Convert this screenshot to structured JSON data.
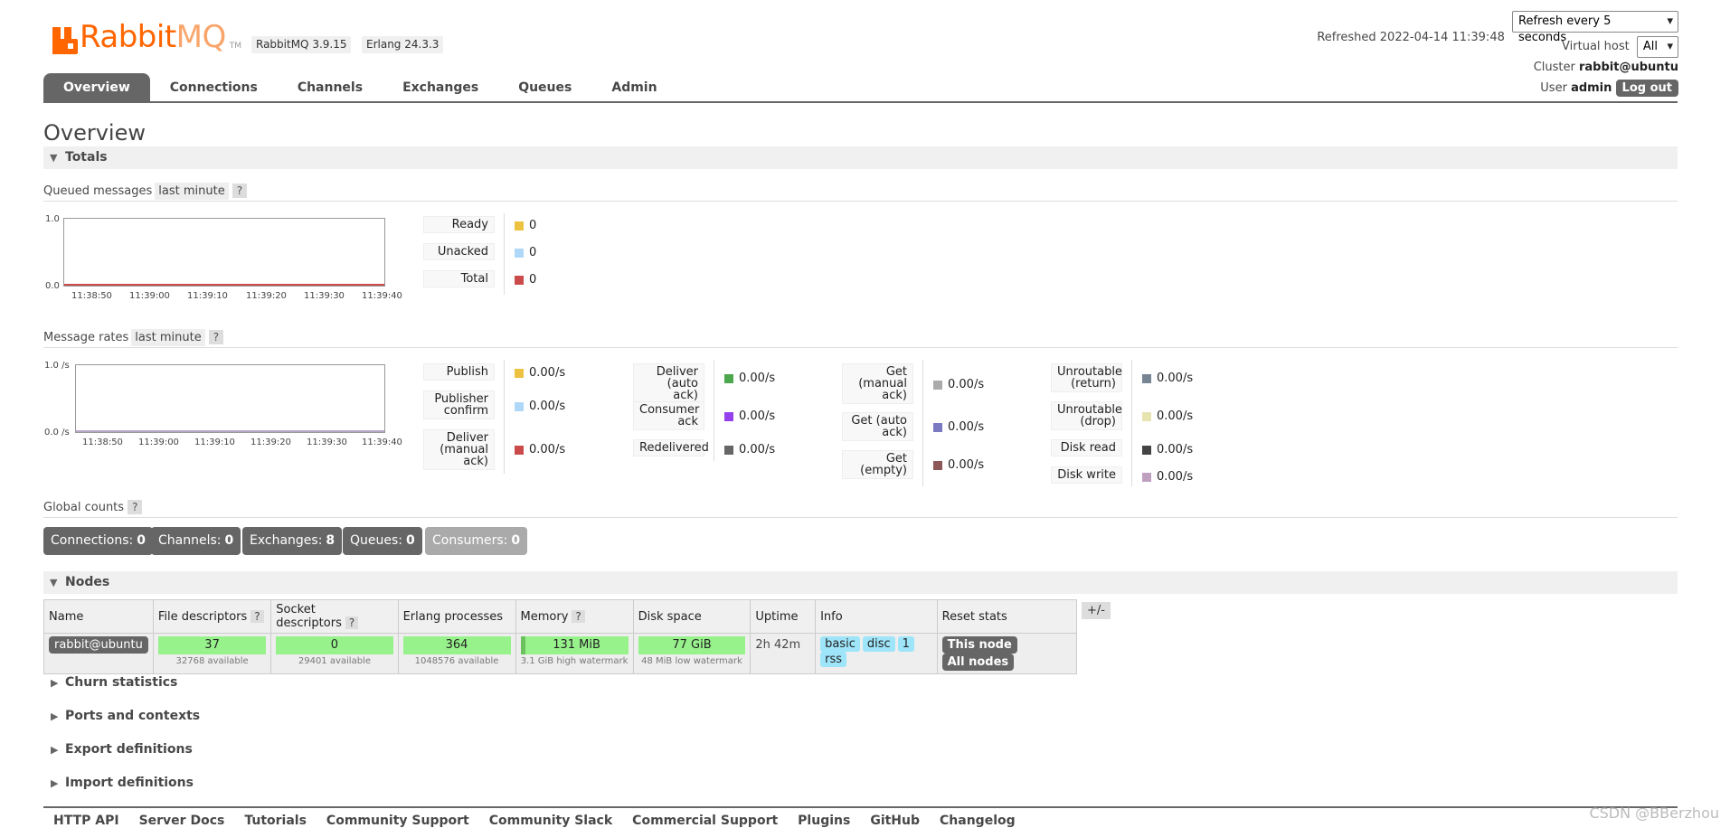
{
  "app": {
    "logo_text_a": "Rabbit",
    "logo_text_b": "MQ",
    "tm": "TM",
    "version": "RabbitMQ 3.9.15",
    "erlang": "Erlang 24.3.3"
  },
  "status": {
    "refreshed_label": "Refreshed 2022-04-14 11:39:48",
    "refresh_select": "Refresh every 5 seconds",
    "vhost_label": "Virtual host",
    "vhost_select": "All",
    "cluster_label": "Cluster",
    "cluster_value": "rabbit@ubuntu",
    "user_label": "User",
    "user_value": "admin",
    "logout": "Log out"
  },
  "tabs": [
    {
      "label": "Overview",
      "active": true
    },
    {
      "label": "Connections"
    },
    {
      "label": "Channels"
    },
    {
      "label": "Exchanges"
    },
    {
      "label": "Queues"
    },
    {
      "label": "Admin"
    }
  ],
  "page_title": "Overview",
  "totals": {
    "header": "Totals",
    "queued": {
      "title": "Queued messages",
      "range": "last minute",
      "help": "?",
      "chart": {
        "y_top": "1.0",
        "y_bottom": "0.0",
        "x_ticks": [
          "11:38:50",
          "11:39:00",
          "11:39:10",
          "11:39:20",
          "11:39:30",
          "11:39:40"
        ]
      },
      "legend": [
        {
          "label": "Ready",
          "value": "0",
          "color": "#edc240"
        },
        {
          "label": "Unacked",
          "value": "0",
          "color": "#afd8f8"
        },
        {
          "label": "Total",
          "value": "0",
          "color": "#cb4b4b"
        }
      ]
    },
    "rates": {
      "title": "Message rates",
      "range": "last minute",
      "help": "?",
      "chart": {
        "y_top": "1.0 /s",
        "y_bottom": "0.0 /s",
        "x_ticks": [
          "11:38:50",
          "11:39:00",
          "11:39:10",
          "11:39:20",
          "11:39:30",
          "11:39:40"
        ]
      },
      "col1": [
        {
          "label": "Publish",
          "value": "0.00/s",
          "color": "#edc240"
        },
        {
          "label": "Publisher confirm",
          "value": "0.00/s",
          "color": "#afd8f8"
        },
        {
          "label": "Deliver (manual ack)",
          "value": "0.00/s",
          "color": "#cb4b4b"
        }
      ],
      "col2": [
        {
          "label": "Deliver (auto ack)",
          "value": "0.00/s",
          "color": "#4da74d"
        },
        {
          "label": "Consumer ack",
          "value": "0.00/s",
          "color": "#9440ed"
        },
        {
          "label": "Redelivered",
          "value": "0.00/s",
          "color": "#666666"
        }
      ],
      "col3": [
        {
          "label": "Get (manual ack)",
          "value": "0.00/s",
          "color": "#aaaaaa"
        },
        {
          "label": "Get (auto ack)",
          "value": "0.00/s",
          "color": "#7c79c3"
        },
        {
          "label": "Get (empty)",
          "value": "0.00/s",
          "color": "#8d5858"
        }
      ],
      "col4": [
        {
          "label": "Unroutable (return)",
          "value": "0.00/s",
          "color": "#758593"
        },
        {
          "label": "Unroutable (drop)",
          "value": "0.00/s",
          "color": "#e8e4b0"
        },
        {
          "label": "Disk read",
          "value": "0.00/s",
          "color": "#444444"
        },
        {
          "label": "Disk write",
          "value": "0.00/s",
          "color": "#c0a0c0"
        }
      ]
    },
    "global": {
      "title": "Global counts",
      "help": "?",
      "items": [
        {
          "label": "Connections:",
          "value": "0"
        },
        {
          "label": "Channels:",
          "value": "0"
        },
        {
          "label": "Exchanges:",
          "value": "8"
        },
        {
          "label": "Queues:",
          "value": "0"
        },
        {
          "label": "Consumers:",
          "value": "0"
        }
      ]
    }
  },
  "nodes": {
    "header": "Nodes",
    "columns": {
      "name": "Name",
      "fd": "File descriptors",
      "sd": "Socket descriptors",
      "ep": "Erlang processes",
      "mem": "Memory",
      "disk": "Disk space",
      "uptime": "Uptime",
      "info": "Info",
      "reset": "Reset stats",
      "help": "?",
      "plusminus": "+/-"
    },
    "row": {
      "name": "rabbit@ubuntu",
      "fd": "37",
      "fd_sub": "32768 available",
      "sd": "0",
      "sd_sub": "29401 available",
      "ep": "364",
      "ep_sub": "1048576 available",
      "mem": "131 MiB",
      "mem_sub": "3.1 GiB high watermark",
      "disk": "77 GiB",
      "disk_sub": "48 MiB low watermark",
      "uptime": "2h 42m",
      "info": [
        "basic",
        "disc",
        "1",
        "rss"
      ],
      "this_node": "This node",
      "all_nodes": "All nodes"
    }
  },
  "collapsed": [
    "Churn statistics",
    "Ports and contexts",
    "Export definitions",
    "Import definitions"
  ],
  "footer": [
    "HTTP API",
    "Server Docs",
    "Tutorials",
    "Community Support",
    "Community Slack",
    "Commercial Support",
    "Plugins",
    "GitHub",
    "Changelog"
  ],
  "watermark": "CSDN @BBerzhou"
}
